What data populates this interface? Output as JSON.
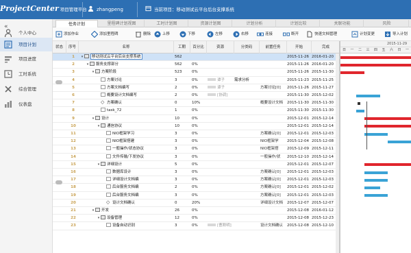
{
  "app": {
    "logo_main": "ProjectCenter",
    "logo_sub": "项目管理平台",
    "username": "zhangpeng",
    "current_project": "当前项目：移动测试云平台后台支撑系统"
  },
  "sidebar": {
    "collapse_icon": "«",
    "items": [
      {
        "label": "个人中心",
        "icon": "person-icon"
      },
      {
        "label": "项目计划",
        "icon": "plan-icon",
        "active": true
      },
      {
        "label": "项目进度",
        "icon": "progress-icon"
      },
      {
        "label": "工时系统",
        "icon": "clock-icon"
      },
      {
        "label": "综合管理",
        "icon": "tools-icon"
      },
      {
        "label": "仪表盘",
        "icon": "dashboard-icon"
      }
    ]
  },
  "tabs": [
    "任务计划",
    "里程碑计划视图",
    "工时计划图",
    "资源计划图",
    "计划分析",
    "计划比较",
    "关联功能",
    "风险"
  ],
  "toolbar": {
    "buttons": [
      "添加作业",
      "添加里程碑",
      "删除",
      "上移",
      "下移",
      "左移",
      "右移",
      "连接",
      "断开",
      "快速文档管理",
      "计划变更",
      "导入计划"
    ]
  },
  "grid": {
    "headers": {
      "status": "状态",
      "seq": "序号",
      "name": "名称",
      "hours": "工期",
      "pct": "百分比",
      "resource": "资源",
      "phase": "分类码",
      "predecessor": "前置任务",
      "start": "开始",
      "end": "完成"
    },
    "rows": [
      {
        "seq": "1",
        "level": 0,
        "kind": "folder",
        "name": "移动测试云平台后台支撑系统",
        "hours": "562",
        "pct": "",
        "res": "",
        "phase": "",
        "pre": "",
        "start": "2015-11-26",
        "end": "2016-01-20",
        "selected": true
      },
      {
        "seq": "2",
        "level": 1,
        "kind": "folder",
        "name": "服务支撑部分",
        "hours": "562",
        "pct": "0%",
        "res": "",
        "phase": "",
        "pre": "",
        "start": "2015-11-26",
        "end": "2016-01-20"
      },
      {
        "seq": "3",
        "level": 2,
        "kind": "folder",
        "name": "方案阶段",
        "hours": "523",
        "pct": "0%",
        "res": "",
        "phase": "",
        "pre": "",
        "start": "2015-11-26",
        "end": "2015-11-30"
      },
      {
        "seq": "4",
        "level": 3,
        "kind": "task",
        "name": "方案讨论",
        "hours": "3",
        "pct": "0%",
        "res": "谭子",
        "phase": "需求分析",
        "pre": "",
        "start": "2015-11-23",
        "end": "2015-11-25"
      },
      {
        "seq": "5",
        "level": 3,
        "kind": "task",
        "name": "方案文档编写",
        "hours": "2",
        "pct": "0%",
        "res": "谭子",
        "phase": "",
        "pre": "方案讨论[0]",
        "start": "2015-11-26",
        "end": "2015-11-27"
      },
      {
        "seq": "6",
        "level": 3,
        "kind": "task",
        "name": "概要设计文档编写",
        "hours": "2",
        "pct": "0%",
        "res": "[协调]",
        "phase": "",
        "pre": "",
        "start": "2015-11-30",
        "end": "2015-12-02"
      },
      {
        "seq": "7",
        "level": 3,
        "kind": "mile",
        "name": "方案确认",
        "hours": "0",
        "pct": "10%",
        "res": "",
        "phase": "",
        "pre": "概要设计文档",
        "start": "2015-11-30",
        "end": "2015-11-30"
      },
      {
        "seq": "8",
        "level": 3,
        "kind": "task",
        "name": "task_72",
        "hours": "1",
        "pct": "0%",
        "res": "",
        "phase": "",
        "pre": "",
        "start": "2015-11-30",
        "end": "2015-11-30"
      },
      {
        "seq": "9",
        "level": 2,
        "kind": "folder",
        "name": "设计",
        "hours": "10",
        "pct": "0%",
        "res": "",
        "phase": "",
        "pre": "",
        "start": "2015-12-01",
        "end": "2015-12-14"
      },
      {
        "seq": "10",
        "level": 3,
        "kind": "folder",
        "name": "通信协议",
        "hours": "10",
        "pct": "0%",
        "res": "",
        "phase": "",
        "pre": "",
        "start": "2015-12-01",
        "end": "2015-12-14"
      },
      {
        "seq": "11",
        "level": 4,
        "kind": "task",
        "name": "NIO框架学习",
        "hours": "3",
        "pct": "0%",
        "res": "",
        "phase": "",
        "pre": "方案确认[0]",
        "start": "2015-12-01",
        "end": "2015-12-03"
      },
      {
        "seq": "12",
        "level": 4,
        "kind": "task",
        "name": "NIO框架搭建",
        "hours": "3",
        "pct": "0%",
        "res": "",
        "phase": "",
        "pre": "NIO框架学",
        "start": "2015-12-04",
        "end": "2015-12-08"
      },
      {
        "seq": "13",
        "level": 4,
        "kind": "task",
        "name": "一般操作/状态协议",
        "hours": "3",
        "pct": "0%",
        "res": "",
        "phase": "",
        "pre": "NIO框架搭",
        "start": "2015-12-09",
        "end": "2015-12-11"
      },
      {
        "seq": "14",
        "level": 4,
        "kind": "task",
        "name": "文件传输/下发协议",
        "hours": "3",
        "pct": "0%",
        "res": "",
        "phase": "",
        "pre": "一般操作/状",
        "start": "2015-12-10",
        "end": "2015-12-14"
      },
      {
        "seq": "15",
        "level": 3,
        "kind": "folder",
        "name": "详细设计",
        "hours": "5",
        "pct": "0%",
        "res": "",
        "phase": "",
        "pre": "",
        "start": "2015-12-01",
        "end": "2015-12-07"
      },
      {
        "seq": "16",
        "level": 4,
        "kind": "task",
        "name": "数据库设计",
        "hours": "3",
        "pct": "0%",
        "res": "",
        "phase": "",
        "pre": "方案确认[0]",
        "start": "2015-12-01",
        "end": "2015-12-03"
      },
      {
        "seq": "17",
        "level": 4,
        "kind": "task",
        "name": "详细设计文档编",
        "hours": "3",
        "pct": "0%",
        "res": "",
        "phase": "",
        "pre": "方案确认[0]",
        "start": "2015-12-01",
        "end": "2015-12-03"
      },
      {
        "seq": "18",
        "level": 4,
        "kind": "task",
        "name": "后台服务文档编",
        "hours": "2",
        "pct": "0%",
        "res": "",
        "phase": "",
        "pre": "方案确认[0]",
        "start": "2015-12-01",
        "end": "2015-12-02"
      },
      {
        "seq": "19",
        "level": 4,
        "kind": "task",
        "name": "后台服务文档编",
        "hours": "3",
        "pct": "0%",
        "res": "",
        "phase": "",
        "pre": "方案确认[0]",
        "start": "2015-12-01",
        "end": "2015-12-03"
      },
      {
        "seq": "20",
        "level": 4,
        "kind": "mile",
        "name": "设计文档确认",
        "hours": "0",
        "pct": "20%",
        "res": "",
        "phase": "",
        "pre": "详细设计文档",
        "start": "2015-12-07",
        "end": "2015-12-07"
      },
      {
        "seq": "21",
        "level": 2,
        "kind": "folder",
        "name": "开发",
        "hours": "26",
        "pct": "0%",
        "res": "",
        "phase": "",
        "pre": "",
        "start": "2015-12-08",
        "end": "2016-01-12"
      },
      {
        "seq": "22",
        "level": 3,
        "kind": "folder",
        "name": "设备管理",
        "hours": "12",
        "pct": "0%",
        "res": "",
        "phase": "",
        "pre": "",
        "start": "2015-12-08",
        "end": "2015-12-23"
      },
      {
        "seq": "23",
        "level": 4,
        "kind": "task",
        "name": "设备自动识别",
        "hours": "3",
        "pct": "0%",
        "res": "[曹刚明]",
        "phase": "",
        "pre": "设计文档确认",
        "start": "2015-12-08",
        "end": "2015-12-10"
      }
    ]
  },
  "gantt": {
    "week_label": "2015-11-29",
    "day_labels": [
      "日",
      "一",
      "二",
      "三",
      "四",
      "五",
      "六",
      "日",
      "一"
    ],
    "bar_colors": {
      "summary": "#e0262d",
      "task": "#3aa3d6"
    }
  }
}
